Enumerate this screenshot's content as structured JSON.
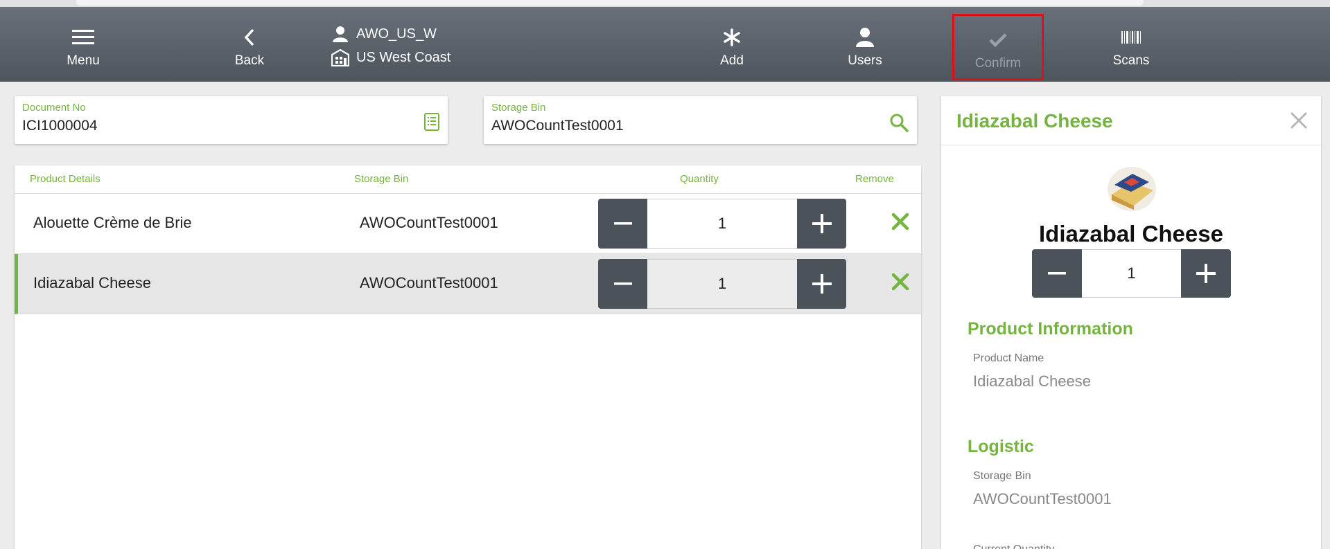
{
  "toolbar": {
    "menu_label": "Menu",
    "back_label": "Back",
    "user": "AWO_US_W",
    "warehouse": "US West Coast",
    "add_label": "Add",
    "users_label": "Users",
    "confirm_label": "Confirm",
    "scans_label": "Scans"
  },
  "document": {
    "label": "Document No",
    "value": "ICI1000004"
  },
  "storage_bin": {
    "label": "Storage Bin",
    "value": "AWOCountTest0001"
  },
  "table": {
    "headers": {
      "product": "Product Details",
      "bin": "Storage Bin",
      "quantity": "Quantity",
      "remove": "Remove"
    },
    "rows": [
      {
        "product": "Alouette Crème de Brie",
        "bin": "AWOCountTest0001",
        "quantity": "1"
      },
      {
        "product": "Idiazabal Cheese",
        "bin": "AWOCountTest0001",
        "quantity": "1"
      }
    ]
  },
  "detail": {
    "title": "Idiazabal Cheese",
    "name": "Idiazabal Cheese",
    "quantity": "1",
    "product_info_title": "Product Information",
    "product_name_label": "Product Name",
    "product_name_value": "Idiazabal Cheese",
    "logistic_title": "Logistic",
    "storage_bin_label": "Storage Bin",
    "storage_bin_value": "AWOCountTest0001",
    "current_quantity_label": "Current Quantity"
  },
  "colors": {
    "accent": "#74b43f",
    "toolbar": "#5b6169",
    "highlight": "#e0101a"
  }
}
